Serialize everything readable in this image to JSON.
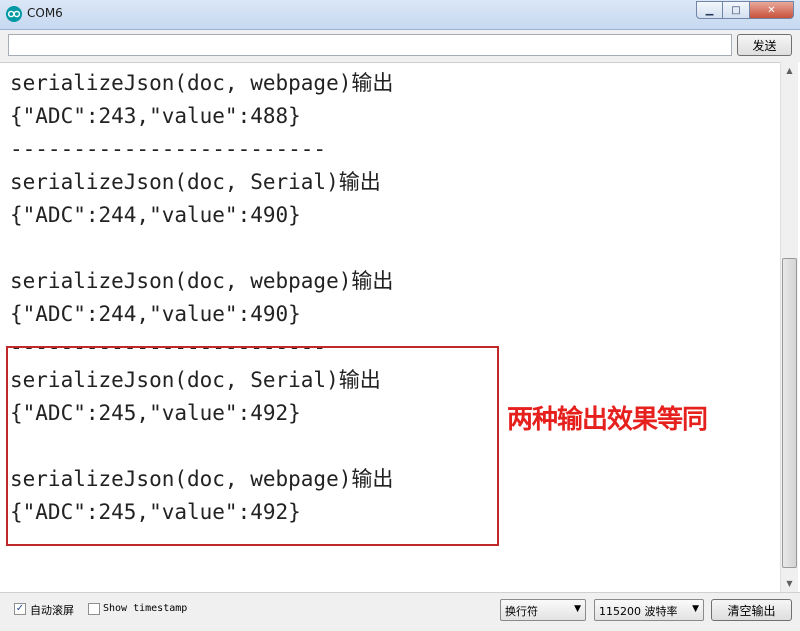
{
  "window": {
    "title": "COM6",
    "minimize_glyph": "▁",
    "maximize_glyph": "□",
    "close_glyph": "✕",
    "icon": "arduino-infinity-icon"
  },
  "input": {
    "value": "",
    "send_label": "发送"
  },
  "output_lines": [
    "serializeJson(doc, webpage)输出",
    "{\"ADC\":243,\"value\":488}",
    "-------------------------",
    "serializeJson(doc, Serial)输出",
    "{\"ADC\":244,\"value\":490}",
    "",
    "serializeJson(doc, webpage)输出",
    "{\"ADC\":244,\"value\":490}",
    "-------------------------",
    "serializeJson(doc, Serial)输出",
    "{\"ADC\":245,\"value\":492}",
    "",
    "serializeJson(doc, webpage)输出",
    "{\"ADC\":245,\"value\":492}"
  ],
  "annotation": {
    "text": "两种输出效果等同",
    "color": "#e5201d"
  },
  "bottom": {
    "autoscroll_label": "自动滚屏",
    "autoscroll_checked": true,
    "timestamp_label": "Show timestamp",
    "timestamp_checked": false,
    "line_ending": "换行符",
    "baud": "115200 波特率",
    "clear_label": "清空输出"
  }
}
